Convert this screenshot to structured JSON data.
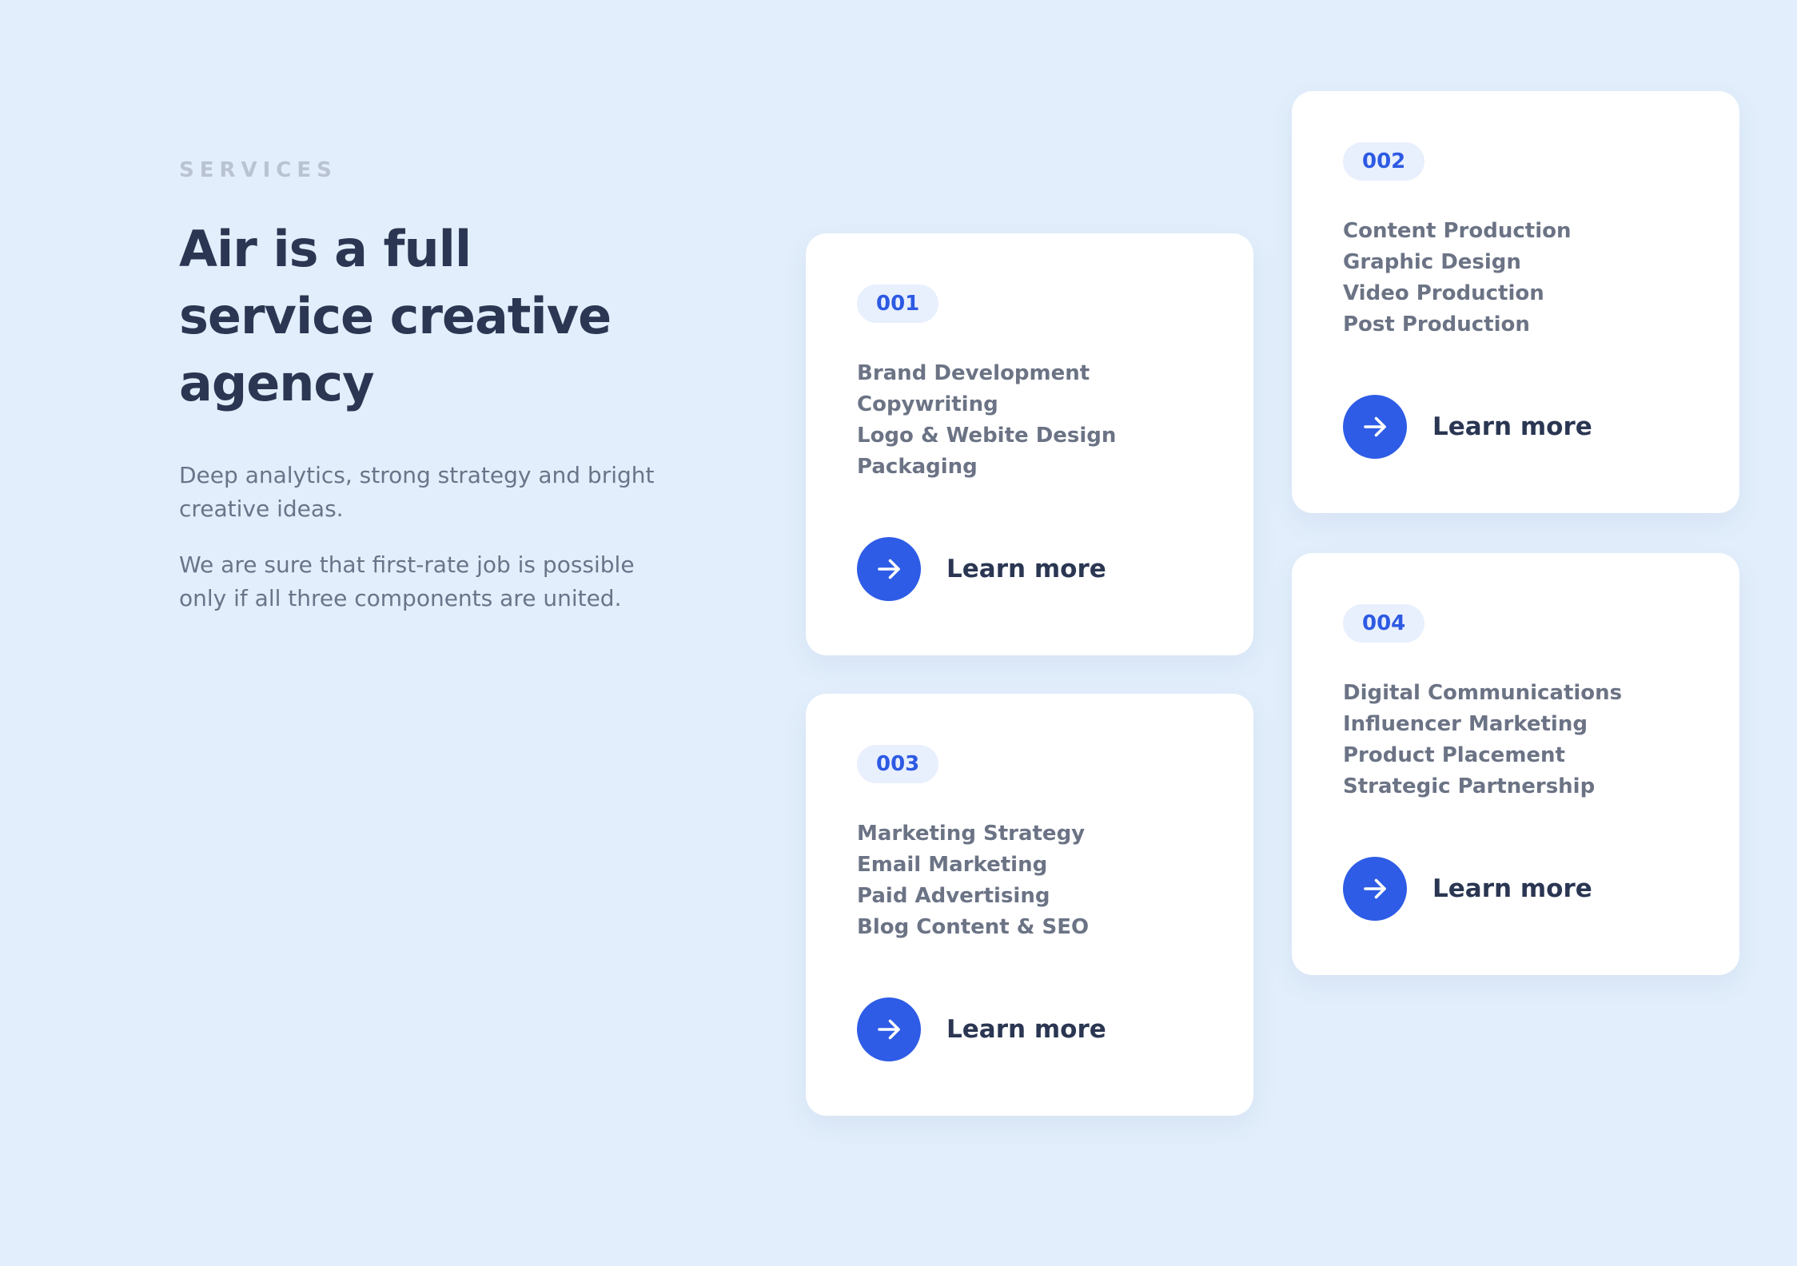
{
  "section": {
    "eyebrow": "SERVICES",
    "title": "Air is a full service creative agency",
    "paragraphs": [
      "Deep analytics, strong strategy and bright creative ideas.",
      "We are sure that first-rate job is possible only if all three components are united."
    ]
  },
  "colors": {
    "background": "#e2eefb",
    "accent": "#2e5ce6",
    "heading": "#2a3652",
    "body_text": "#6b7385",
    "badge_bg": "#e8effd"
  },
  "cards": [
    {
      "number": "001",
      "items": [
        "Brand Development",
        "Copywriting",
        "Logo & Webite Design",
        "Packaging"
      ],
      "cta_label": "Learn more",
      "cta_icon": "arrow-right-icon"
    },
    {
      "number": "002",
      "items": [
        "Content Production",
        "Graphic Design",
        "Video Production",
        "Post Production"
      ],
      "cta_label": "Learn more",
      "cta_icon": "arrow-right-icon"
    },
    {
      "number": "003",
      "items": [
        "Marketing Strategy",
        "Email Marketing",
        "Paid Advertising",
        "Blog Content & SEO"
      ],
      "cta_label": "Learn more",
      "cta_icon": "arrow-right-icon"
    },
    {
      "number": "004",
      "items": [
        "Digital Communications",
        "Influencer Marketing",
        "Product Placement",
        "Strategic Partnership"
      ],
      "cta_label": "Learn more",
      "cta_icon": "arrow-right-icon"
    }
  ]
}
